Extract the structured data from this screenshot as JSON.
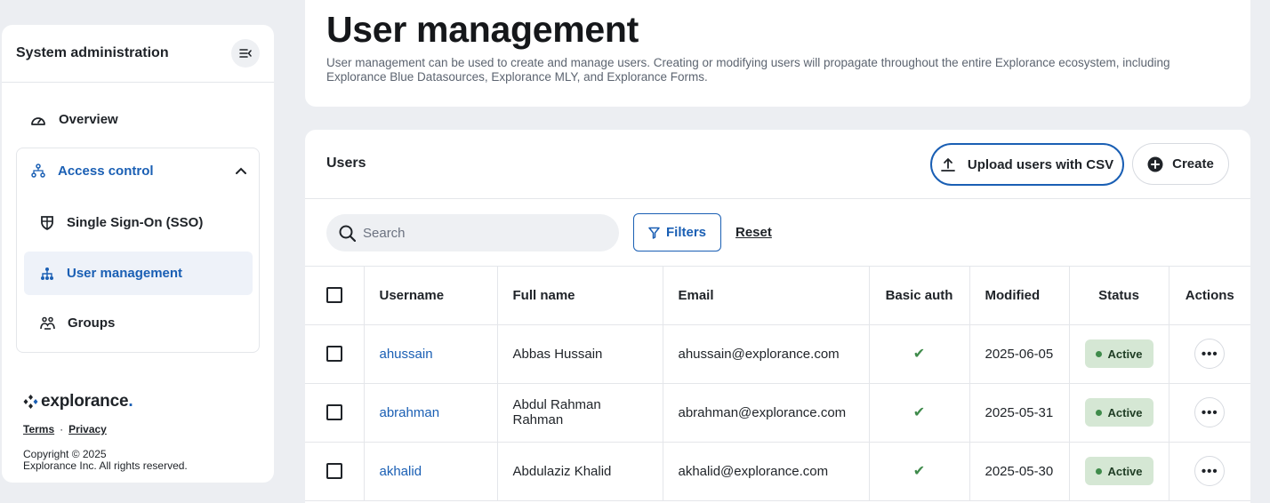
{
  "sidebar": {
    "title": "System administration",
    "overview_label": "Overview",
    "access_control_label": "Access control",
    "sub_items": [
      {
        "label": "Single Sign-On (SSO)",
        "icon": "shield-icon"
      },
      {
        "label": "User management",
        "icon": "org-chart-icon",
        "active": true
      },
      {
        "label": "Groups",
        "icon": "group-icon"
      }
    ],
    "logo_text": "explorance",
    "logo_dot": ".",
    "terms_label": "Terms",
    "separator": "·",
    "privacy_label": "Privacy",
    "copyright_line1": "Copyright © 2025",
    "copyright_line2": "Explorance Inc. All rights reserved."
  },
  "header": {
    "title": "User management",
    "description": "User management can be used to create and manage users. Creating or modifying users will propagate throughout the entire Explorance ecosystem, including Explorance Blue Datasources, Explorance MLY, and Explorance Forms."
  },
  "users": {
    "title": "Users",
    "upload_label": "Upload users with CSV",
    "create_label": "Create",
    "search_placeholder": "Search",
    "filters_label": "Filters",
    "reset_label": "Reset",
    "columns": [
      "Username",
      "Full name",
      "Email",
      "Basic auth",
      "Modified",
      "Status",
      "Actions"
    ],
    "rows": [
      {
        "username": "ahussain",
        "full_name": "Abbas Hussain",
        "email": "ahussain@explorance.com",
        "basic_auth": "✔",
        "modified": "2025-06-05",
        "status": "Active",
        "actions": "•••"
      },
      {
        "username": "abrahman",
        "full_name": "Abdul Rahman Rahman",
        "email": "abrahman@explorance.com",
        "basic_auth": "✔",
        "modified": "2025-05-31",
        "status": "Active",
        "actions": "•••"
      },
      {
        "username": "akhalid",
        "full_name": "Abdulaziz Khalid",
        "email": "akhalid@explorance.com",
        "basic_auth": "✔",
        "modified": "2025-05-30",
        "status": "Active",
        "actions": "•••"
      }
    ]
  },
  "colors": {
    "accent": "#1a5fb4",
    "status_active_bg": "#d5e7d4",
    "status_active_dot": "#3f8b4b",
    "background": "#eceef2"
  }
}
